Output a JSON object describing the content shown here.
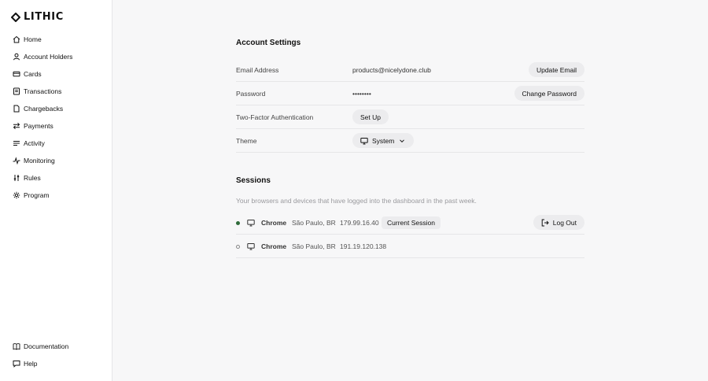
{
  "brand": {
    "name": "LITHIC"
  },
  "nav": {
    "items": [
      {
        "label": "Home",
        "icon": "home-icon"
      },
      {
        "label": "Account Holders",
        "icon": "user-icon"
      },
      {
        "label": "Cards",
        "icon": "card-icon"
      },
      {
        "label": "Transactions",
        "icon": "list-icon"
      },
      {
        "label": "Chargebacks",
        "icon": "document-icon"
      },
      {
        "label": "Payments",
        "icon": "arrows-icon"
      },
      {
        "label": "Activity",
        "icon": "activity-icon"
      },
      {
        "label": "Monitoring",
        "icon": "pulse-icon"
      },
      {
        "label": "Rules",
        "icon": "sliders-icon"
      },
      {
        "label": "Program",
        "icon": "gear-icon"
      }
    ],
    "bottom": [
      {
        "label": "Documentation",
        "icon": "book-icon"
      },
      {
        "label": "Help",
        "icon": "chat-icon"
      }
    ]
  },
  "account": {
    "title": "Account Settings",
    "email_label": "Email Address",
    "email_value": "products@nicelydone.club",
    "email_button": "Update Email",
    "password_label": "Password",
    "password_value": "••••••••",
    "password_button": "Change Password",
    "twofa_label": "Two-Factor Authentication",
    "twofa_button": "Set Up",
    "theme_label": "Theme",
    "theme_value": "System"
  },
  "sessions": {
    "title": "Sessions",
    "description": "Your browsers and devices that have logged into the dashboard in the past week.",
    "logout_button": "Log Out",
    "rows": [
      {
        "active": true,
        "browser": "Chrome",
        "location": "São Paulo, BR",
        "ip": "179.99.16.40",
        "badge": "Current Session"
      },
      {
        "active": false,
        "browser": "Chrome",
        "location": "São Paulo, BR",
        "ip": "191.19.120.138"
      }
    ]
  },
  "colors": {
    "active_dot": "#2f6b3a",
    "button_bg": "#ececee",
    "background": "#f7f7f8"
  }
}
